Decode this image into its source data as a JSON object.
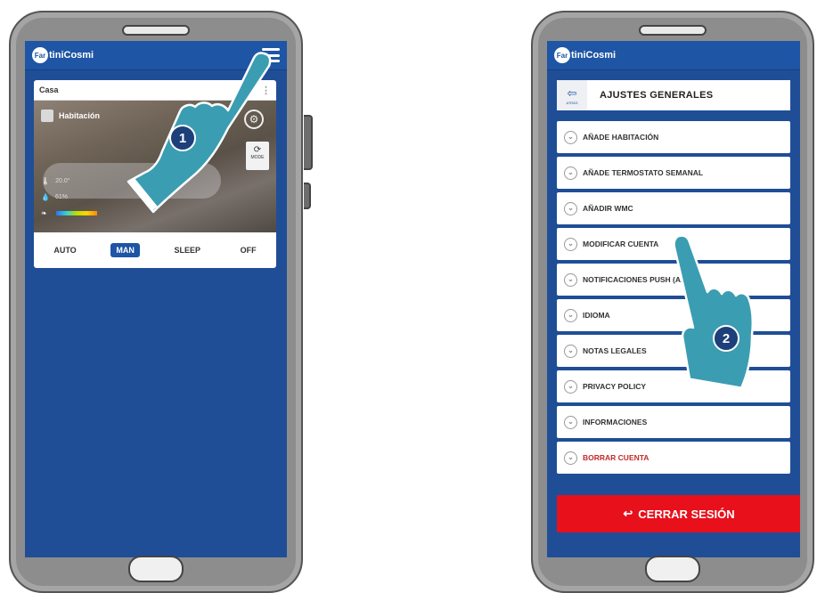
{
  "app": {
    "logo_text": "tiniCosmi",
    "logo_prefix": "Far"
  },
  "phone1": {
    "card_title": "Casa",
    "room_name": "Habitación",
    "wiz_label": "MODE",
    "stat_temp": "20.0°",
    "stat_hum": "61%",
    "modes": [
      "AUTO",
      "MAN",
      "SLEEP",
      "OFF"
    ],
    "active_mode": "MAN",
    "step_number": "1"
  },
  "phone2": {
    "back_label": "ATRÁS",
    "title": "AJUSTES GENERALES",
    "menu": [
      {
        "label": "AÑADE HABITACIÓN"
      },
      {
        "label": "AÑADE TERMOSTATO SEMANAL"
      },
      {
        "label": "AÑADIR WMC"
      },
      {
        "label": "MODIFICAR CUENTA"
      },
      {
        "label": "NOTIFICACIONES PUSH (APP)"
      },
      {
        "label": "IDIOMA"
      },
      {
        "label": "NOTAS LEGALES"
      },
      {
        "label": "PRIVACY POLICY"
      },
      {
        "label": "INFORMACIONES"
      },
      {
        "label": "BORRAR CUENTA"
      }
    ],
    "logout_label": "CERRAR SESIÓN",
    "step_number": "2"
  },
  "colors": {
    "brand_blue": "#1e55a5",
    "logout_red": "#e8101b",
    "hand_teal": "#3a9bb0"
  },
  "icons": [
    "hamburger-icon",
    "gear-icon",
    "back-arrow-icon",
    "chevron-down-icon",
    "logout-arrow-icon",
    "thermometer-icon",
    "humidity-icon",
    "leaf-icon"
  ]
}
